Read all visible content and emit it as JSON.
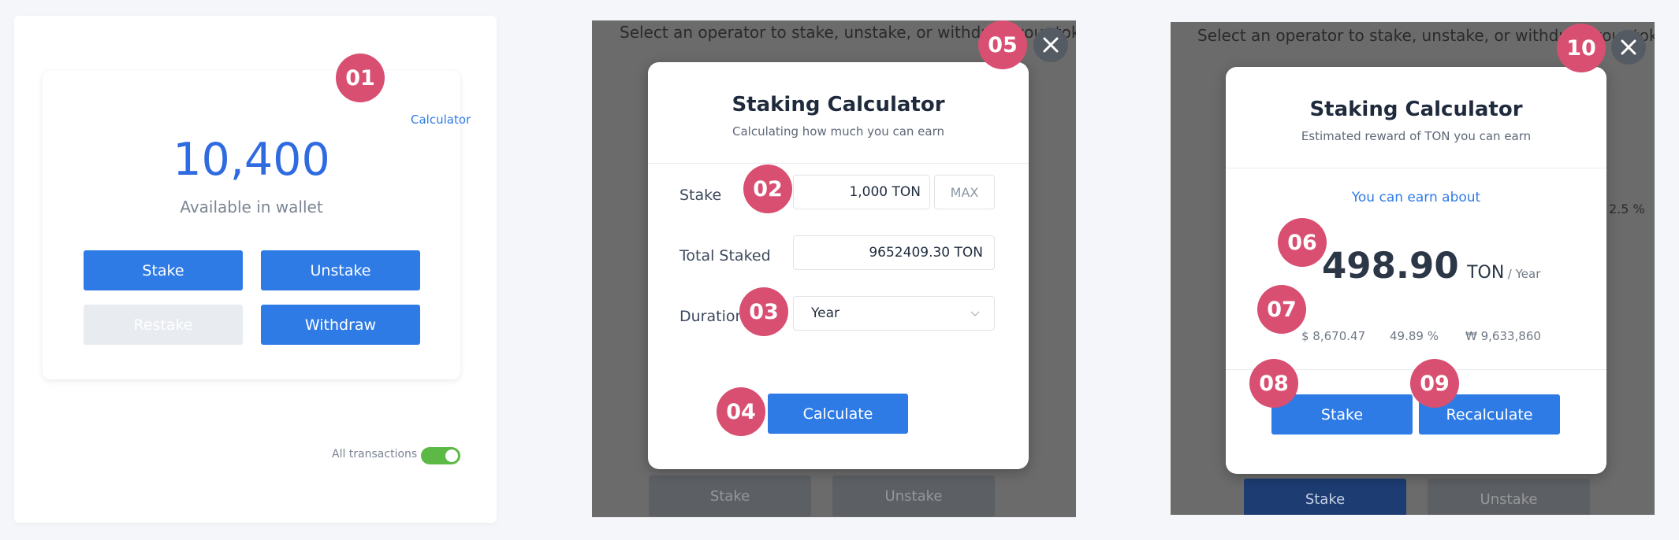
{
  "panel1": {
    "calculator_link": "Calculator",
    "amount": "10,400",
    "available_label": "Available in wallet",
    "buttons": {
      "stake": "Stake",
      "unstake": "Unstake",
      "restake": "Restake",
      "withdraw": "Withdraw"
    },
    "all_transactions_label": "All transactions",
    "toggle_state": "on"
  },
  "panel2": {
    "background_text": "Select an operator to stake, unstake, or withdraw your toke",
    "background_buttons": {
      "stake": "Stake",
      "unstake": "Unstake"
    },
    "modal": {
      "title": "Staking Calculator",
      "subtitle": "Calculating how much you can earn",
      "stake_label": "Stake",
      "stake_value": "1,000 TON",
      "max_label": "MAX",
      "total_staked_label": "Total Staked",
      "total_staked_value": "9652409.30 TON",
      "duration_label": "Duration",
      "duration_value": "Year",
      "calculate_button": "Calculate"
    },
    "close_icon": "close-icon"
  },
  "panel3": {
    "background_text": "Select an operator to stake, unstake, or withdraw your toke",
    "background_rate": "2.5 %",
    "background_buttons": {
      "stake": "Stake",
      "unstake": "Unstake"
    },
    "modal": {
      "title": "Staking Calculator",
      "subtitle": "Estimated reward of TON you can earn",
      "earn_label": "You can earn about",
      "reward_value": "498.90",
      "reward_unit": "TON",
      "reward_period": "/ Year",
      "usd_value": "$ 8,670.47",
      "percent_value": "49.89 %",
      "krw_value": "₩ 9,633,860",
      "stake_button": "Stake",
      "recalculate_button": "Recalculate"
    },
    "close_icon": "close-icon"
  },
  "badges": [
    "01",
    "02",
    "03",
    "04",
    "05",
    "06",
    "07",
    "08",
    "09",
    "10"
  ],
  "colors": {
    "primary": "#2f7be6",
    "badge": "#d84f71",
    "toggle_on": "#5cb946",
    "overlay": "#6b6b6b"
  }
}
